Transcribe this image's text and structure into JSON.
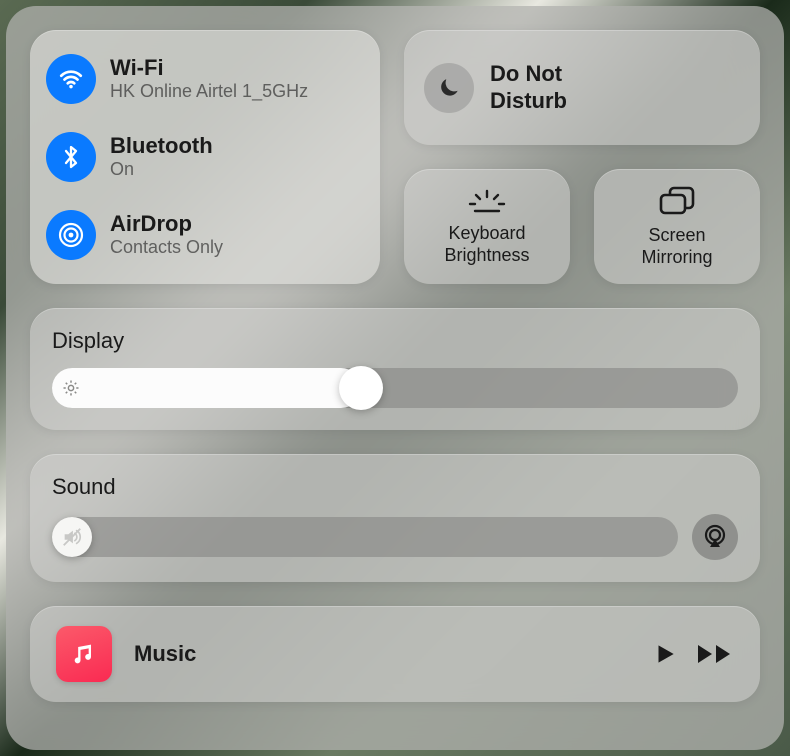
{
  "connectivity": {
    "wifi": {
      "title": "Wi-Fi",
      "sub": "HK Online Airtel 1_5GHz",
      "active": true
    },
    "bluetooth": {
      "title": "Bluetooth",
      "sub": "On",
      "active": true
    },
    "airdrop": {
      "title": "AirDrop",
      "sub": "Contacts Only",
      "active": true
    }
  },
  "dnd": {
    "title": "Do Not\nDisturb",
    "active": false
  },
  "keyboard_brightness": {
    "label": "Keyboard\nBrightness"
  },
  "screen_mirroring": {
    "label": "Screen\nMirroring"
  },
  "display": {
    "title": "Display",
    "value_percent": 45
  },
  "sound": {
    "title": "Sound",
    "value_percent": 0
  },
  "music": {
    "title": "Music"
  }
}
